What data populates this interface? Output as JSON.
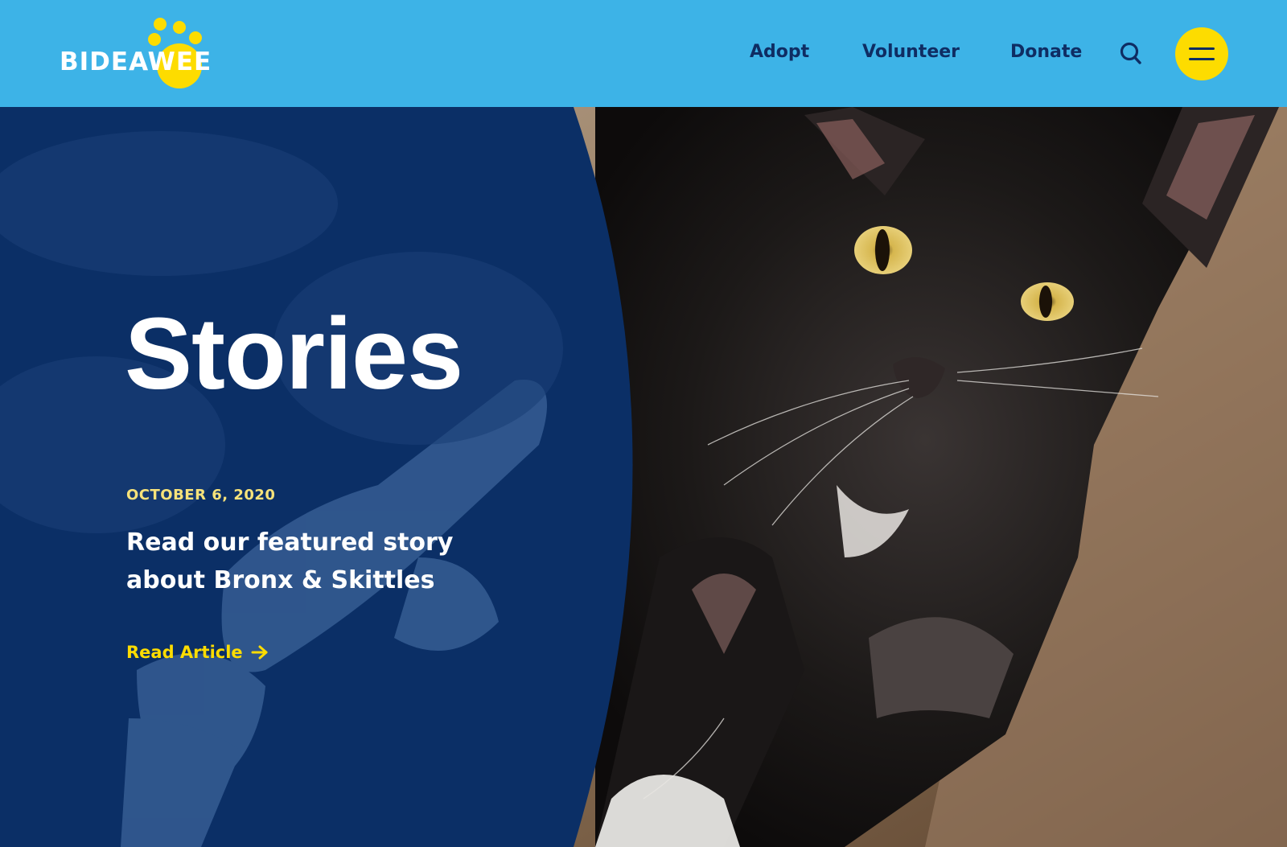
{
  "brand": {
    "logo_text": "BIDEAWEE",
    "colors": {
      "header_bg": "#3db3e7",
      "nav_text": "#0f2d63",
      "accent_yellow": "#fddc00",
      "panel_blue": "#0b2f66",
      "date_yellow": "#f6e27a"
    }
  },
  "nav": {
    "items": [
      {
        "label": "Adopt"
      },
      {
        "label": "Volunteer"
      },
      {
        "label": "Donate"
      }
    ],
    "search_icon": "search-icon",
    "menu_icon": "hamburger-menu-icon"
  },
  "hero": {
    "title": "Stories",
    "date": "OCTOBER 6, 2020",
    "summary": "Read our featured story about Bronx & Skittles",
    "cta_label": "Read Article",
    "cta_icon": "arrow-right-icon"
  }
}
